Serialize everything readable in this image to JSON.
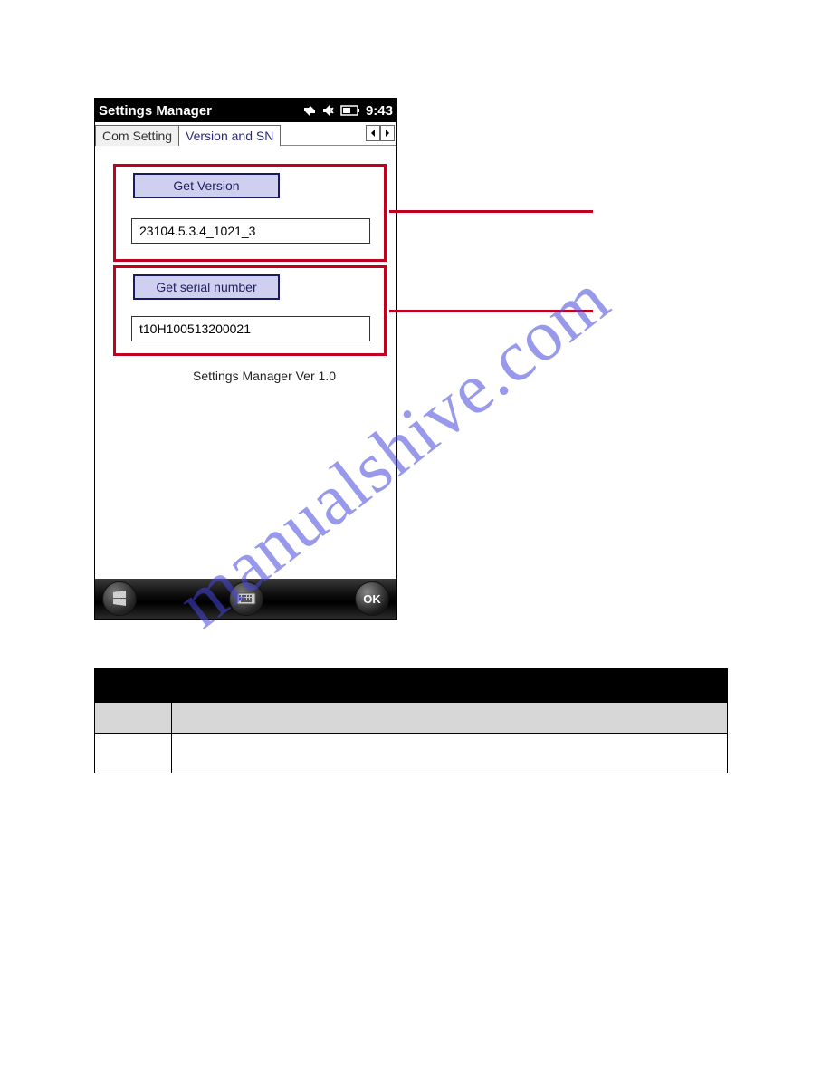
{
  "titlebar": {
    "title": "Settings Manager",
    "clock": "9:43"
  },
  "icons": {
    "sync": "sync-icon",
    "volume": "volume-icon",
    "battery": "battery-icon"
  },
  "tabs": {
    "com_setting": "Com Setting",
    "version_sn": "Version and SN"
  },
  "buttons": {
    "get_version": "Get Version",
    "get_serial": "Get serial number",
    "ok": "OK"
  },
  "fields": {
    "version_value": "23104.5.3.4_1021_3",
    "serial_value": "t10H100513200021"
  },
  "footer_label": "Settings Manager Ver 1.0",
  "watermark": "manualshive.com"
}
